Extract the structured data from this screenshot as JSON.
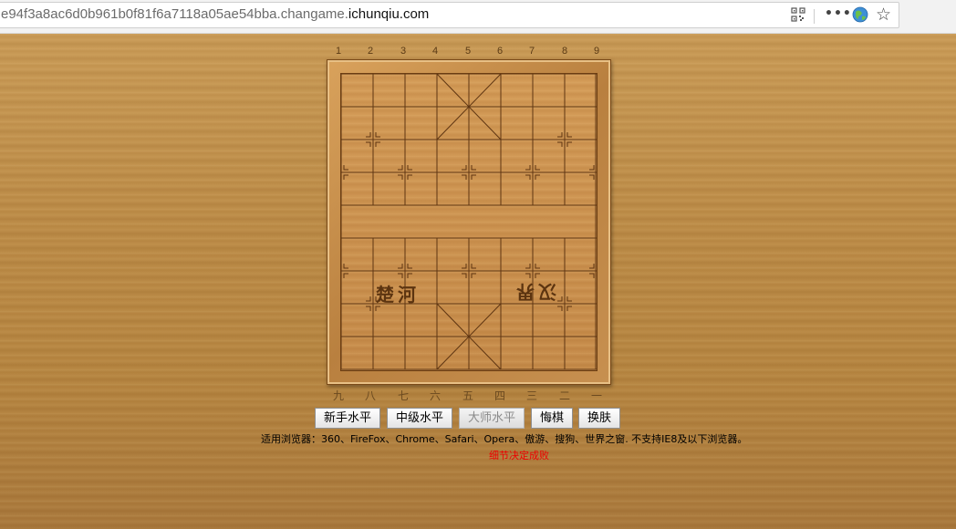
{
  "browser": {
    "url_prefix": "e94f3a8ac6d0b961b0f81f6a7118a05ae54bba.changame.",
    "url_domain": "ichunqiu.com",
    "icons": [
      "qr-code-icon",
      "more-icon",
      "globe-icon",
      "star-icon"
    ],
    "more_glyph": "•••",
    "star_glyph": "☆"
  },
  "board": {
    "top_numbers": [
      "1",
      "2",
      "3",
      "4",
      "5",
      "6",
      "7",
      "8",
      "9"
    ],
    "bottom_numbers": [
      "九",
      "八",
      "七",
      "六",
      "五",
      "四",
      "三",
      "二",
      "一"
    ],
    "river_left": "楚河",
    "river_right": "汉界"
  },
  "controls": {
    "novice": "新手水平",
    "intermediate": "中级水平",
    "master": "大师水平",
    "undo": "悔棋",
    "skin": "换肤"
  },
  "footer": {
    "support": "适用浏览器：360、FireFox、Chrome、Safari、Opera、傲游、搜狗、世界之窗. 不支持IE8及以下浏览器。",
    "motto": "细节决定成败"
  },
  "colors": {
    "background_wood": "#b98845",
    "board_wood": "#c58a48",
    "grid_line": "#5e3512",
    "motto_color": "#ee0000"
  }
}
